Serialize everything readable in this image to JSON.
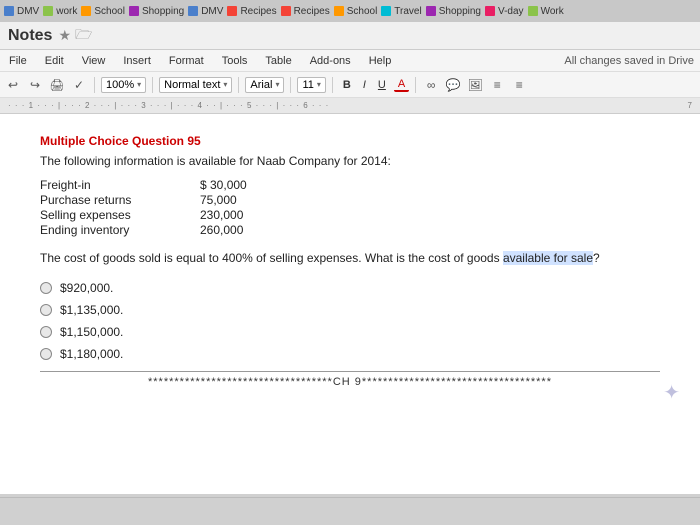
{
  "tabs": [
    {
      "label": "DMV",
      "color": "#4a7fcb"
    },
    {
      "label": "work",
      "color": "#8bc34a"
    },
    {
      "label": "School",
      "color": "#ff9800"
    },
    {
      "label": "Shopping",
      "color": "#9c27b0"
    },
    {
      "label": "DMV",
      "color": "#4a7fcb"
    },
    {
      "label": "Recipes",
      "color": "#f44336"
    },
    {
      "label": "Recipes",
      "color": "#f44336"
    },
    {
      "label": "School",
      "color": "#ff9800"
    },
    {
      "label": "Travel",
      "color": "#00bcd4"
    },
    {
      "label": "Shopping",
      "color": "#9c27b0"
    },
    {
      "label": "V-day",
      "color": "#e91e63"
    },
    {
      "label": "Work",
      "color": "#8bc34a"
    }
  ],
  "title_bar": {
    "app_title": "Notes",
    "star_label": "★",
    "folder_label": "🗁"
  },
  "menu_bar": {
    "items": [
      "File",
      "Edit",
      "View",
      "Insert",
      "Format",
      "Tools",
      "Table",
      "Add-ons",
      "Help"
    ],
    "saved_text": "All changes saved in Drive"
  },
  "toolbar": {
    "zoom": "100%",
    "zoom_arrow": "▾",
    "style": "Normal text",
    "style_arrow": "▾",
    "font": "Arial",
    "font_arrow": "▾",
    "size": "11",
    "size_arrow": "▾"
  },
  "format_bar": {
    "bold": "B",
    "italic": "I",
    "underline": "U",
    "underline_color": "A",
    "link_icon": "∞",
    "comment_icon": "≡",
    "align_icon": "≡",
    "more_icon": "≡"
  },
  "ruler": {
    "marks": [
      "· · · 1 · · · | · · · 2 · · · | · · · 3 · · · | · · · 4 · · | · · · 5 · · · | · · · 6 · · ·",
      "7"
    ]
  },
  "document": {
    "question_title": "Multiple Choice Question 95",
    "question_intro": "The following information is available for Naab Company for 2014:",
    "data_rows": [
      {
        "label": "Freight-in",
        "value": "$  30,000"
      },
      {
        "label": "Purchase returns",
        "value": "75,000"
      },
      {
        "label": "Selling expenses",
        "value": "230,000"
      },
      {
        "label": "Ending inventory",
        "value": "260,000"
      }
    ],
    "question_text": "The cost of goods sold is equal to 400% of selling expenses. What is the cost of goods available for sale?",
    "highlight_phrase": "available for sale",
    "options": [
      {
        "label": "$920,000."
      },
      {
        "label": "$1,135,000."
      },
      {
        "label": "$1,150,000."
      },
      {
        "label": "$1,180,000."
      }
    ],
    "chapter_marker": "***********************************CH 9************************************"
  }
}
